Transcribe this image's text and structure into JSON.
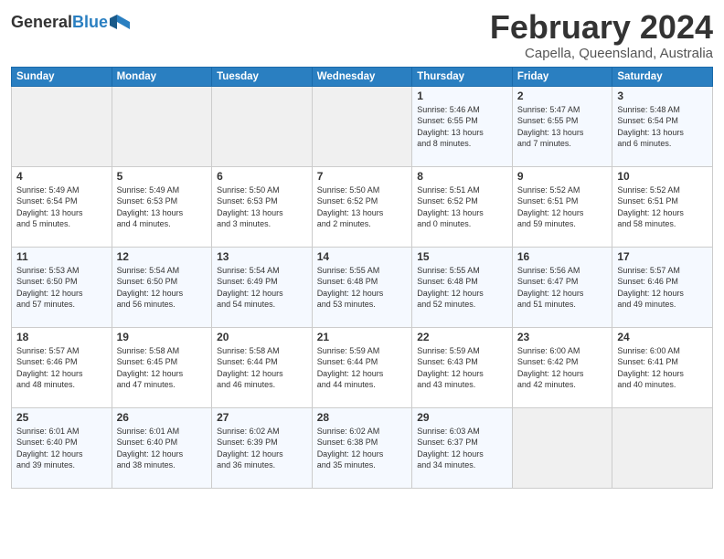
{
  "header": {
    "logo_general": "General",
    "logo_blue": "Blue",
    "month_title": "February 2024",
    "location": "Capella, Queensland, Australia"
  },
  "days_of_week": [
    "Sunday",
    "Monday",
    "Tuesday",
    "Wednesday",
    "Thursday",
    "Friday",
    "Saturday"
  ],
  "weeks": [
    [
      {
        "day": "",
        "info": ""
      },
      {
        "day": "",
        "info": ""
      },
      {
        "day": "",
        "info": ""
      },
      {
        "day": "",
        "info": ""
      },
      {
        "day": "1",
        "info": "Sunrise: 5:46 AM\nSunset: 6:55 PM\nDaylight: 13 hours\nand 8 minutes."
      },
      {
        "day": "2",
        "info": "Sunrise: 5:47 AM\nSunset: 6:55 PM\nDaylight: 13 hours\nand 7 minutes."
      },
      {
        "day": "3",
        "info": "Sunrise: 5:48 AM\nSunset: 6:54 PM\nDaylight: 13 hours\nand 6 minutes."
      }
    ],
    [
      {
        "day": "4",
        "info": "Sunrise: 5:49 AM\nSunset: 6:54 PM\nDaylight: 13 hours\nand 5 minutes."
      },
      {
        "day": "5",
        "info": "Sunrise: 5:49 AM\nSunset: 6:53 PM\nDaylight: 13 hours\nand 4 minutes."
      },
      {
        "day": "6",
        "info": "Sunrise: 5:50 AM\nSunset: 6:53 PM\nDaylight: 13 hours\nand 3 minutes."
      },
      {
        "day": "7",
        "info": "Sunrise: 5:50 AM\nSunset: 6:52 PM\nDaylight: 13 hours\nand 2 minutes."
      },
      {
        "day": "8",
        "info": "Sunrise: 5:51 AM\nSunset: 6:52 PM\nDaylight: 13 hours\nand 0 minutes."
      },
      {
        "day": "9",
        "info": "Sunrise: 5:52 AM\nSunset: 6:51 PM\nDaylight: 12 hours\nand 59 minutes."
      },
      {
        "day": "10",
        "info": "Sunrise: 5:52 AM\nSunset: 6:51 PM\nDaylight: 12 hours\nand 58 minutes."
      }
    ],
    [
      {
        "day": "11",
        "info": "Sunrise: 5:53 AM\nSunset: 6:50 PM\nDaylight: 12 hours\nand 57 minutes."
      },
      {
        "day": "12",
        "info": "Sunrise: 5:54 AM\nSunset: 6:50 PM\nDaylight: 12 hours\nand 56 minutes."
      },
      {
        "day": "13",
        "info": "Sunrise: 5:54 AM\nSunset: 6:49 PM\nDaylight: 12 hours\nand 54 minutes."
      },
      {
        "day": "14",
        "info": "Sunrise: 5:55 AM\nSunset: 6:48 PM\nDaylight: 12 hours\nand 53 minutes."
      },
      {
        "day": "15",
        "info": "Sunrise: 5:55 AM\nSunset: 6:48 PM\nDaylight: 12 hours\nand 52 minutes."
      },
      {
        "day": "16",
        "info": "Sunrise: 5:56 AM\nSunset: 6:47 PM\nDaylight: 12 hours\nand 51 minutes."
      },
      {
        "day": "17",
        "info": "Sunrise: 5:57 AM\nSunset: 6:46 PM\nDaylight: 12 hours\nand 49 minutes."
      }
    ],
    [
      {
        "day": "18",
        "info": "Sunrise: 5:57 AM\nSunset: 6:46 PM\nDaylight: 12 hours\nand 48 minutes."
      },
      {
        "day": "19",
        "info": "Sunrise: 5:58 AM\nSunset: 6:45 PM\nDaylight: 12 hours\nand 47 minutes."
      },
      {
        "day": "20",
        "info": "Sunrise: 5:58 AM\nSunset: 6:44 PM\nDaylight: 12 hours\nand 46 minutes."
      },
      {
        "day": "21",
        "info": "Sunrise: 5:59 AM\nSunset: 6:44 PM\nDaylight: 12 hours\nand 44 minutes."
      },
      {
        "day": "22",
        "info": "Sunrise: 5:59 AM\nSunset: 6:43 PM\nDaylight: 12 hours\nand 43 minutes."
      },
      {
        "day": "23",
        "info": "Sunrise: 6:00 AM\nSunset: 6:42 PM\nDaylight: 12 hours\nand 42 minutes."
      },
      {
        "day": "24",
        "info": "Sunrise: 6:00 AM\nSunset: 6:41 PM\nDaylight: 12 hours\nand 40 minutes."
      }
    ],
    [
      {
        "day": "25",
        "info": "Sunrise: 6:01 AM\nSunset: 6:40 PM\nDaylight: 12 hours\nand 39 minutes."
      },
      {
        "day": "26",
        "info": "Sunrise: 6:01 AM\nSunset: 6:40 PM\nDaylight: 12 hours\nand 38 minutes."
      },
      {
        "day": "27",
        "info": "Sunrise: 6:02 AM\nSunset: 6:39 PM\nDaylight: 12 hours\nand 36 minutes."
      },
      {
        "day": "28",
        "info": "Sunrise: 6:02 AM\nSunset: 6:38 PM\nDaylight: 12 hours\nand 35 minutes."
      },
      {
        "day": "29",
        "info": "Sunrise: 6:03 AM\nSunset: 6:37 PM\nDaylight: 12 hours\nand 34 minutes."
      },
      {
        "day": "",
        "info": ""
      },
      {
        "day": "",
        "info": ""
      }
    ]
  ]
}
